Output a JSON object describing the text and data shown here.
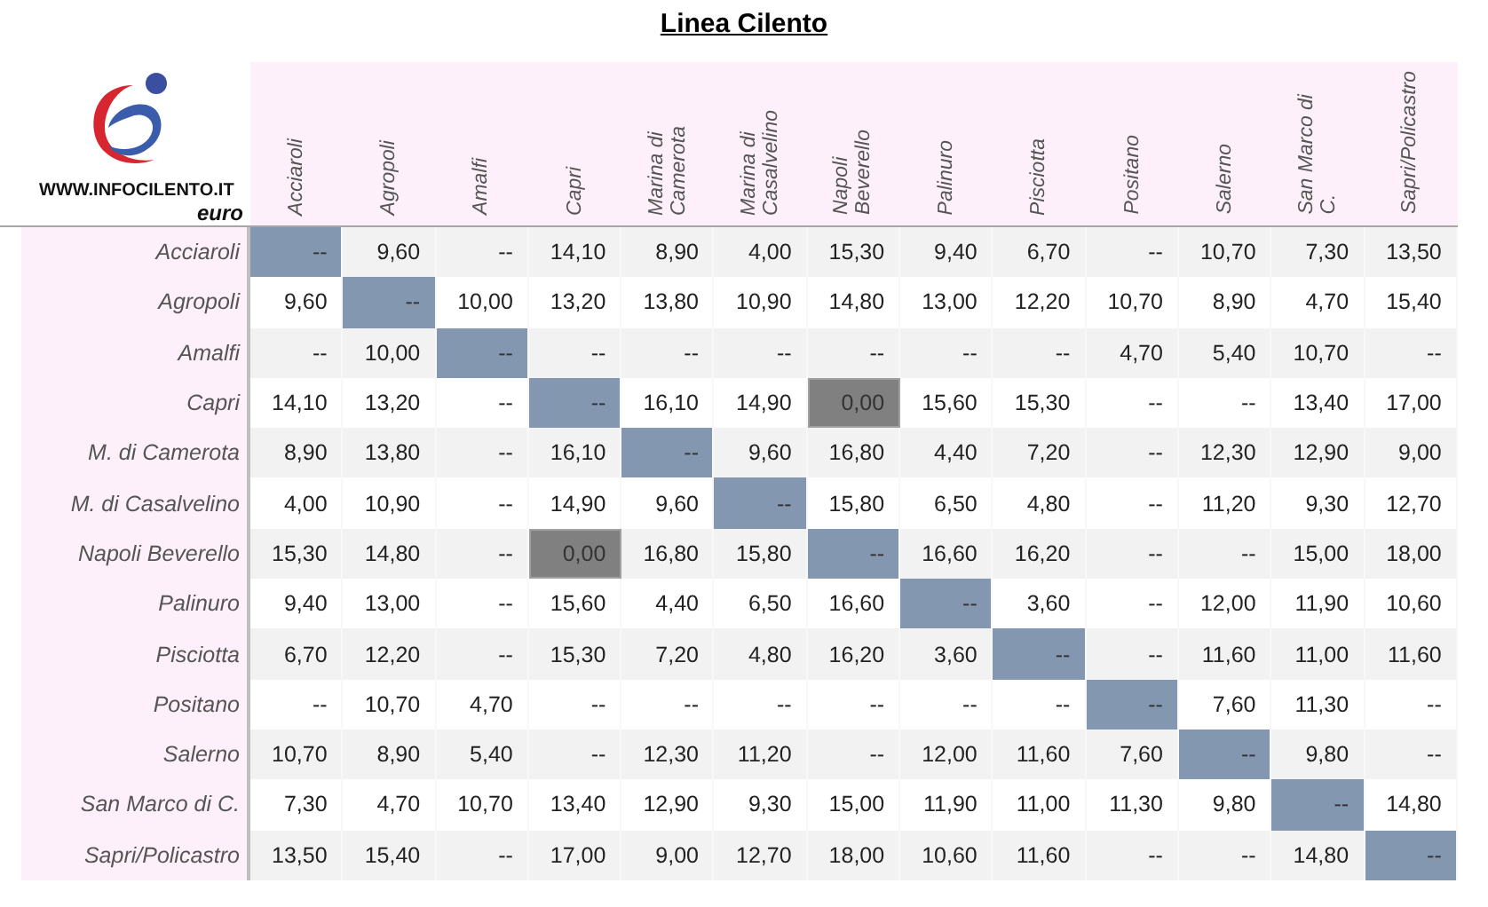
{
  "title": "Linea Cilento",
  "logo": {
    "site": "WWW.INFOCILENTO.IT"
  },
  "unit": "euro",
  "columns": [
    "Acciaroli",
    "Agropoli",
    "Amalfi",
    "Capri",
    "Marina di\nCamerota",
    "Marina di\nCasalvelino",
    "Napoli\nBeverello",
    "Palinuro",
    "Pisciotta",
    "Positano",
    "Salerno",
    "San Marco di\nC.",
    "Sapri/Policastro"
  ],
  "rows": [
    {
      "label": "Acciaroli",
      "cells": [
        {
          "value": "--",
          "kind": "diagonal"
        },
        {
          "value": "9,60",
          "kind": "plain"
        },
        {
          "value": "--",
          "kind": "plain"
        },
        {
          "value": "14,10",
          "kind": "plain"
        },
        {
          "value": "8,90",
          "kind": "plain"
        },
        {
          "value": "4,00",
          "kind": "plain"
        },
        {
          "value": "15,30",
          "kind": "plain"
        },
        {
          "value": "9,40",
          "kind": "plain"
        },
        {
          "value": "6,70",
          "kind": "plain"
        },
        {
          "value": "--",
          "kind": "plain"
        },
        {
          "value": "10,70",
          "kind": "plain"
        },
        {
          "value": "7,30",
          "kind": "plain"
        },
        {
          "value": "13,50",
          "kind": "plain"
        }
      ]
    },
    {
      "label": "Agropoli",
      "cells": [
        {
          "value": "9,60",
          "kind": "plain"
        },
        {
          "value": "--",
          "kind": "diagonal"
        },
        {
          "value": "10,00",
          "kind": "plain"
        },
        {
          "value": "13,20",
          "kind": "plain"
        },
        {
          "value": "13,80",
          "kind": "plain"
        },
        {
          "value": "10,90",
          "kind": "plain"
        },
        {
          "value": "14,80",
          "kind": "plain"
        },
        {
          "value": "13,00",
          "kind": "plain"
        },
        {
          "value": "12,20",
          "kind": "plain"
        },
        {
          "value": "10,70",
          "kind": "plain"
        },
        {
          "value": "8,90",
          "kind": "plain"
        },
        {
          "value": "4,70",
          "kind": "plain"
        },
        {
          "value": "15,40",
          "kind": "plain"
        }
      ]
    },
    {
      "label": "Amalfi",
      "cells": [
        {
          "value": "--",
          "kind": "plain"
        },
        {
          "value": "10,00",
          "kind": "plain"
        },
        {
          "value": "--",
          "kind": "diagonal"
        },
        {
          "value": "--",
          "kind": "plain"
        },
        {
          "value": "--",
          "kind": "plain"
        },
        {
          "value": "--",
          "kind": "plain"
        },
        {
          "value": "--",
          "kind": "plain"
        },
        {
          "value": "--",
          "kind": "plain"
        },
        {
          "value": "--",
          "kind": "plain"
        },
        {
          "value": "4,70",
          "kind": "plain"
        },
        {
          "value": "5,40",
          "kind": "plain"
        },
        {
          "value": "10,70",
          "kind": "plain"
        },
        {
          "value": "--",
          "kind": "plain"
        }
      ]
    },
    {
      "label": "Capri",
      "cells": [
        {
          "value": "14,10",
          "kind": "plain"
        },
        {
          "value": "13,20",
          "kind": "plain"
        },
        {
          "value": "--",
          "kind": "plain"
        },
        {
          "value": "--",
          "kind": "diagonal"
        },
        {
          "value": "16,10",
          "kind": "plain"
        },
        {
          "value": "14,90",
          "kind": "plain"
        },
        {
          "value": "0,00",
          "kind": "highlight"
        },
        {
          "value": "15,60",
          "kind": "plain"
        },
        {
          "value": "15,30",
          "kind": "plain"
        },
        {
          "value": "--",
          "kind": "plain"
        },
        {
          "value": "--",
          "kind": "plain"
        },
        {
          "value": "13,40",
          "kind": "plain"
        },
        {
          "value": "17,00",
          "kind": "plain"
        }
      ]
    },
    {
      "label": "M. di Camerota",
      "cells": [
        {
          "value": "8,90",
          "kind": "plain"
        },
        {
          "value": "13,80",
          "kind": "plain"
        },
        {
          "value": "--",
          "kind": "plain"
        },
        {
          "value": "16,10",
          "kind": "plain"
        },
        {
          "value": "--",
          "kind": "diagonal"
        },
        {
          "value": "9,60",
          "kind": "plain"
        },
        {
          "value": "16,80",
          "kind": "plain"
        },
        {
          "value": "4,40",
          "kind": "plain"
        },
        {
          "value": "7,20",
          "kind": "plain"
        },
        {
          "value": "--",
          "kind": "plain"
        },
        {
          "value": "12,30",
          "kind": "plain"
        },
        {
          "value": "12,90",
          "kind": "plain"
        },
        {
          "value": "9,00",
          "kind": "plain"
        }
      ]
    },
    {
      "label": "M. di Casalvelino",
      "cells": [
        {
          "value": "4,00",
          "kind": "plain"
        },
        {
          "value": "10,90",
          "kind": "plain"
        },
        {
          "value": "--",
          "kind": "plain"
        },
        {
          "value": "14,90",
          "kind": "plain"
        },
        {
          "value": "9,60",
          "kind": "plain"
        },
        {
          "value": "--",
          "kind": "diagonal"
        },
        {
          "value": "15,80",
          "kind": "plain"
        },
        {
          "value": "6,50",
          "kind": "plain"
        },
        {
          "value": "4,80",
          "kind": "plain"
        },
        {
          "value": "--",
          "kind": "plain"
        },
        {
          "value": "11,20",
          "kind": "plain"
        },
        {
          "value": "9,30",
          "kind": "plain"
        },
        {
          "value": "12,70",
          "kind": "plain"
        }
      ]
    },
    {
      "label": "Napoli Beverello",
      "cells": [
        {
          "value": "15,30",
          "kind": "plain"
        },
        {
          "value": "14,80",
          "kind": "plain"
        },
        {
          "value": "--",
          "kind": "plain"
        },
        {
          "value": "0,00",
          "kind": "highlight"
        },
        {
          "value": "16,80",
          "kind": "plain"
        },
        {
          "value": "15,80",
          "kind": "plain"
        },
        {
          "value": "--",
          "kind": "diagonal"
        },
        {
          "value": "16,60",
          "kind": "plain"
        },
        {
          "value": "16,20",
          "kind": "plain"
        },
        {
          "value": "--",
          "kind": "plain"
        },
        {
          "value": "--",
          "kind": "plain"
        },
        {
          "value": "15,00",
          "kind": "plain"
        },
        {
          "value": "18,00",
          "kind": "plain"
        }
      ]
    },
    {
      "label": "Palinuro",
      "cells": [
        {
          "value": "9,40",
          "kind": "plain"
        },
        {
          "value": "13,00",
          "kind": "plain"
        },
        {
          "value": "--",
          "kind": "plain"
        },
        {
          "value": "15,60",
          "kind": "plain"
        },
        {
          "value": "4,40",
          "kind": "plain"
        },
        {
          "value": "6,50",
          "kind": "plain"
        },
        {
          "value": "16,60",
          "kind": "plain"
        },
        {
          "value": "--",
          "kind": "diagonal"
        },
        {
          "value": "3,60",
          "kind": "plain"
        },
        {
          "value": "--",
          "kind": "plain"
        },
        {
          "value": "12,00",
          "kind": "plain"
        },
        {
          "value": "11,90",
          "kind": "plain"
        },
        {
          "value": "10,60",
          "kind": "plain"
        }
      ]
    },
    {
      "label": "Pisciotta",
      "cells": [
        {
          "value": "6,70",
          "kind": "plain"
        },
        {
          "value": "12,20",
          "kind": "plain"
        },
        {
          "value": "--",
          "kind": "plain"
        },
        {
          "value": "15,30",
          "kind": "plain"
        },
        {
          "value": "7,20",
          "kind": "plain"
        },
        {
          "value": "4,80",
          "kind": "plain"
        },
        {
          "value": "16,20",
          "kind": "plain"
        },
        {
          "value": "3,60",
          "kind": "plain"
        },
        {
          "value": "--",
          "kind": "diagonal"
        },
        {
          "value": "--",
          "kind": "plain"
        },
        {
          "value": "11,60",
          "kind": "plain"
        },
        {
          "value": "11,00",
          "kind": "plain"
        },
        {
          "value": "11,60",
          "kind": "plain"
        }
      ]
    },
    {
      "label": "Positano",
      "cells": [
        {
          "value": "--",
          "kind": "plain"
        },
        {
          "value": "10,70",
          "kind": "plain"
        },
        {
          "value": "4,70",
          "kind": "plain"
        },
        {
          "value": "--",
          "kind": "plain"
        },
        {
          "value": "--",
          "kind": "plain"
        },
        {
          "value": "--",
          "kind": "plain"
        },
        {
          "value": "--",
          "kind": "plain"
        },
        {
          "value": "--",
          "kind": "plain"
        },
        {
          "value": "--",
          "kind": "plain"
        },
        {
          "value": "--",
          "kind": "diagonal"
        },
        {
          "value": "7,60",
          "kind": "plain"
        },
        {
          "value": "11,30",
          "kind": "plain"
        },
        {
          "value": "--",
          "kind": "plain"
        }
      ]
    },
    {
      "label": "Salerno",
      "cells": [
        {
          "value": "10,70",
          "kind": "plain"
        },
        {
          "value": "8,90",
          "kind": "plain"
        },
        {
          "value": "5,40",
          "kind": "plain"
        },
        {
          "value": "--",
          "kind": "plain"
        },
        {
          "value": "12,30",
          "kind": "plain"
        },
        {
          "value": "11,20",
          "kind": "plain"
        },
        {
          "value": "--",
          "kind": "plain"
        },
        {
          "value": "12,00",
          "kind": "plain"
        },
        {
          "value": "11,60",
          "kind": "plain"
        },
        {
          "value": "7,60",
          "kind": "plain"
        },
        {
          "value": "--",
          "kind": "diagonal"
        },
        {
          "value": "9,80",
          "kind": "plain"
        },
        {
          "value": "--",
          "kind": "plain"
        }
      ]
    },
    {
      "label": "San Marco di C.",
      "cells": [
        {
          "value": "7,30",
          "kind": "plain"
        },
        {
          "value": "4,70",
          "kind": "plain"
        },
        {
          "value": "10,70",
          "kind": "plain"
        },
        {
          "value": "13,40",
          "kind": "plain"
        },
        {
          "value": "12,90",
          "kind": "plain"
        },
        {
          "value": "9,30",
          "kind": "plain"
        },
        {
          "value": "15,00",
          "kind": "plain"
        },
        {
          "value": "11,90",
          "kind": "plain"
        },
        {
          "value": "11,00",
          "kind": "plain"
        },
        {
          "value": "11,30",
          "kind": "plain"
        },
        {
          "value": "9,80",
          "kind": "plain"
        },
        {
          "value": "--",
          "kind": "diagonal"
        },
        {
          "value": "14,80",
          "kind": "plain"
        }
      ]
    },
    {
      "label": "Sapri/Policastro",
      "cells": [
        {
          "value": "13,50",
          "kind": "plain"
        },
        {
          "value": "15,40",
          "kind": "plain"
        },
        {
          "value": "--",
          "kind": "plain"
        },
        {
          "value": "17,00",
          "kind": "plain"
        },
        {
          "value": "9,00",
          "kind": "plain"
        },
        {
          "value": "12,70",
          "kind": "plain"
        },
        {
          "value": "18,00",
          "kind": "plain"
        },
        {
          "value": "10,60",
          "kind": "plain"
        },
        {
          "value": "11,60",
          "kind": "plain"
        },
        {
          "value": "--",
          "kind": "plain"
        },
        {
          "value": "--",
          "kind": "plain"
        },
        {
          "value": "14,80",
          "kind": "plain"
        },
        {
          "value": "--",
          "kind": "diagonal"
        }
      ]
    }
  ]
}
